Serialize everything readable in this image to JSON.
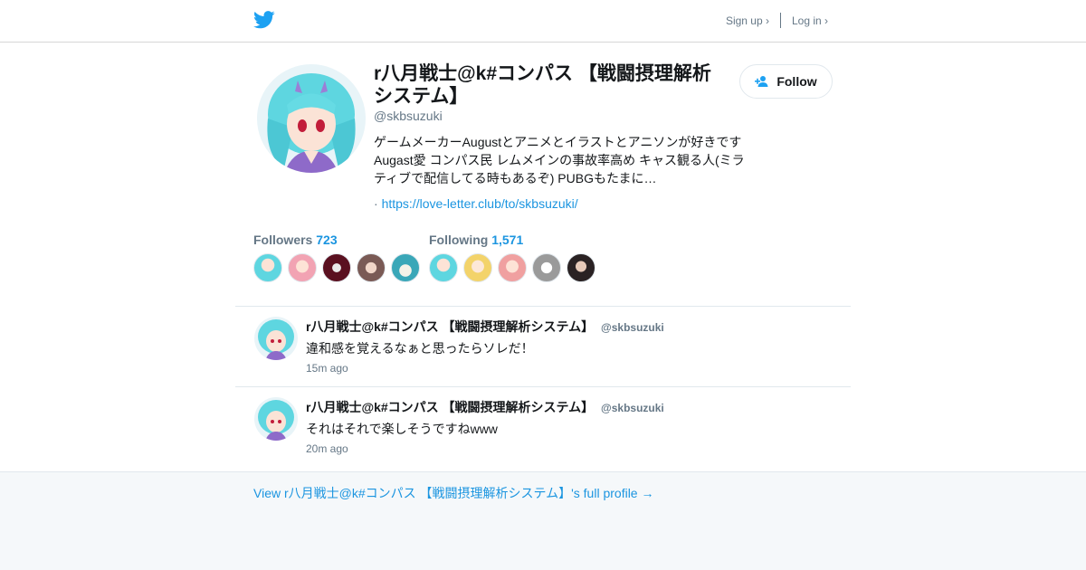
{
  "header": {
    "logo": "twitter-bird-icon",
    "signup_label": "Sign up ›",
    "login_label": "Log in ›"
  },
  "profile": {
    "name": "r八月戦士@k#コンパス 【戦闘摂理解析システム】",
    "handle": "@skbsuzuki",
    "bio": "ゲームメーカーAugustとアニメとイラストとアニソンが好きです Augast愛 コンパス民 レムメインの事故率高め キャス観る人(ミラティブで配信してる時もあるぞ) PUBGもたまに…",
    "link_prefix": "·",
    "link": "https://love-letter.club/to/skbsuzuki/",
    "follow_label": "Follow",
    "followers_label": "Followers",
    "followers_count": "723",
    "following_label": "Following",
    "following_count": "1,571"
  },
  "tweets": [
    {
      "name": "r八月戦士@k#コンパス 【戦闘摂理解析システム】",
      "handle": "@skbsuzuki",
      "text": "違和感を覚えるなぁと思ったらソレだ！",
      "time": "15m ago"
    },
    {
      "name": "r八月戦士@k#コンパス 【戦闘摂理解析システム】",
      "handle": "@skbsuzuki",
      "text": "それはそれで楽しそうですねwww",
      "time": "20m ago"
    }
  ],
  "footer": {
    "full_profile_link": "View r八月戦士@k#コンパス 【戦闘摂理解析システム】's full profile →"
  },
  "colors": {
    "accent": "#1b95e0",
    "secondary_text": "#657786",
    "footer_bg": "#f5f8fa"
  }
}
